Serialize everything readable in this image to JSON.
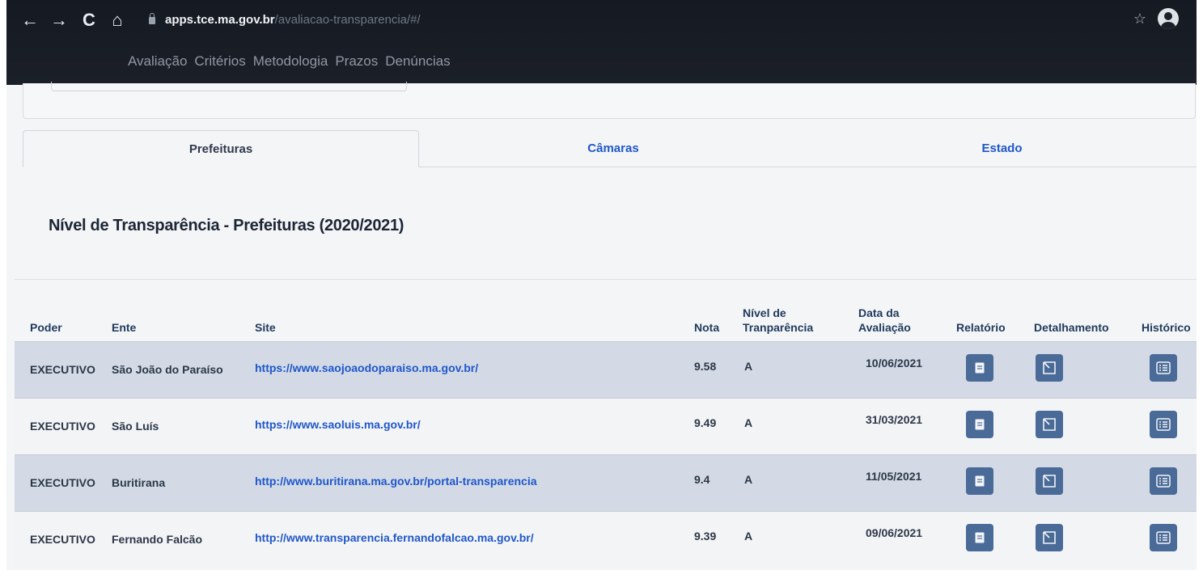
{
  "browser": {
    "back_icon": "←",
    "forward_icon": "→",
    "reload_icon": "C",
    "home_icon": "⌂",
    "url_host": "apps.tce.ma.gov.br",
    "url_path": "/avaliacao-transparencia/#/",
    "star_icon": "☆"
  },
  "nav": {
    "items": [
      "Avaliação",
      "Critérios",
      "Metodologia",
      "Prazos",
      "Denúncias"
    ]
  },
  "tabs": [
    "Prefeituras",
    "Câmaras",
    "Estado"
  ],
  "section_title": "Nível de Transparência - Prefeituras (2020/2021)",
  "table": {
    "headers": {
      "poder": "Poder",
      "ente": "Ente",
      "site": "Site",
      "nota": "Nota",
      "nivel_1": "Nível de",
      "nivel_2": "Tranparência",
      "data_1": "Data da",
      "data_2": "Avaliação",
      "relatorio": "Relatório",
      "detalhamento": "Detalhamento",
      "historico": "Histórico"
    },
    "rows": [
      {
        "poder": "EXECUTIVO",
        "ente": "São João do Paraíso",
        "site": "https://www.saojoaodoparaiso.ma.gov.br/",
        "nota": "9.58",
        "nivel": "A",
        "data": "10/06/2021"
      },
      {
        "poder": "EXECUTIVO",
        "ente": "São Luís",
        "site": "https://www.saoluis.ma.gov.br/",
        "nota": "9.49",
        "nivel": "A",
        "data": "31/03/2021"
      },
      {
        "poder": "EXECUTIVO",
        "ente": "Buritirana",
        "site": "http://www.buritirana.ma.gov.br/portal-transparencia",
        "nota": "9.4",
        "nivel": "A",
        "data": "11/05/2021"
      },
      {
        "poder": "EXECUTIVO",
        "ente": "Fernando Falcão",
        "site": "http://www.transparencia.fernandofalcao.ma.gov.br/",
        "nota": "9.39",
        "nivel": "A",
        "data": "09/06/2021"
      }
    ]
  },
  "colors": {
    "link": "#1f57c9",
    "action_button": "#4a6a97",
    "row_highlight": "#d3dae6"
  },
  "icons": {
    "relatorio": "document-icon",
    "detalhamento": "expand-icon",
    "historico": "list-icon"
  }
}
